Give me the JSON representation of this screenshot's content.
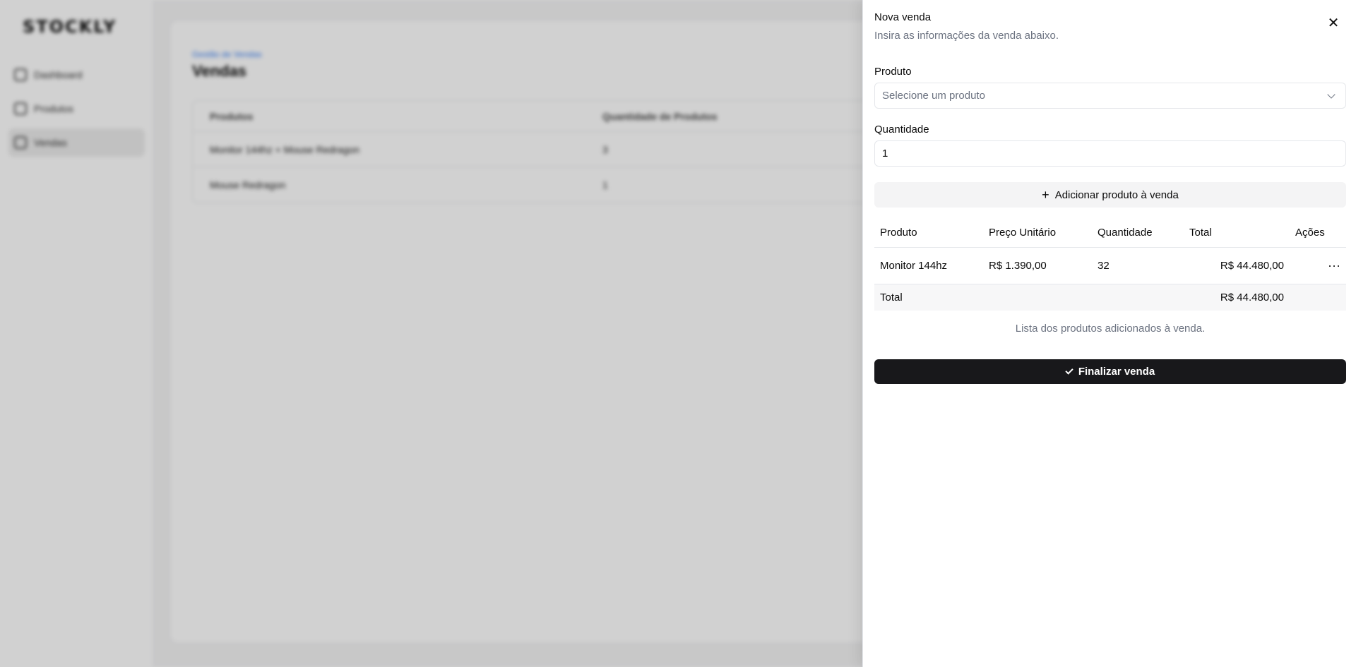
{
  "background": {
    "logo": "STOCKLY",
    "nav": [
      {
        "label": "Dashboard",
        "icon": "dashboard-icon"
      },
      {
        "label": "Produtos",
        "icon": "package-icon"
      },
      {
        "label": "Vendas",
        "icon": "shopping-bag-icon"
      }
    ],
    "breadcrumb": "Gestão de Vendas",
    "title": "Vendas",
    "table": {
      "headers": [
        "Produtos",
        "Quantidade de Produtos"
      ],
      "rows": [
        [
          "Monitor 144hz + Mouse Redragon",
          "3"
        ],
        [
          "Mouse Redragon",
          "1"
        ]
      ]
    }
  },
  "sheet": {
    "title": "Nova venda",
    "description": "Insira as informações da venda abaixo.",
    "product_label": "Produto",
    "product_placeholder": "Selecione um produto",
    "quantity_label": "Quantidade",
    "quantity_value": "1",
    "add_button": "Adicionar produto à venda",
    "table": {
      "headers": [
        "Produto",
        "Preço Unitário",
        "Quantidade",
        "Total",
        "Ações"
      ],
      "rows": [
        {
          "product": "Monitor 144hz",
          "unit_price": "R$ 1.390,00",
          "quantity": "32",
          "total": "R$ 44.480,00"
        }
      ],
      "footer_label": "Total",
      "footer_total": "R$ 44.480,00"
    },
    "caption": "Lista dos produtos adicionados à venda.",
    "finish_button": "Finalizar venda"
  }
}
